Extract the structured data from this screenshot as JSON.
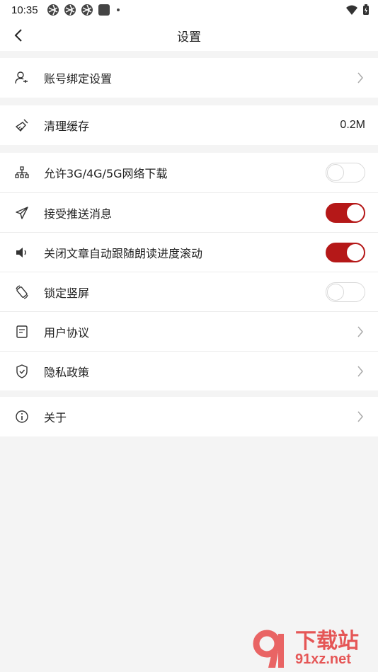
{
  "status_bar": {
    "time": "10:35"
  },
  "header": {
    "title": "设置"
  },
  "groups": {
    "account": {
      "label": "账号绑定设置"
    },
    "cache": {
      "label": "清理缓存",
      "value": "0.2M"
    },
    "prefs": {
      "items": [
        {
          "label": "允许3G/4G/5G网络下载",
          "toggle": false
        },
        {
          "label": "接受推送消息",
          "toggle": true
        },
        {
          "label": "关闭文章自动跟随朗读进度滚动",
          "toggle": true
        },
        {
          "label": "锁定竖屏",
          "toggle": false
        },
        {
          "label": "用户协议"
        },
        {
          "label": "隐私政策"
        }
      ]
    },
    "about": {
      "label": "关于"
    }
  },
  "colors": {
    "accent": "#b51818",
    "background": "#f4f4f4"
  },
  "watermark": {
    "cn": "下载站",
    "en": "91xz.net"
  }
}
